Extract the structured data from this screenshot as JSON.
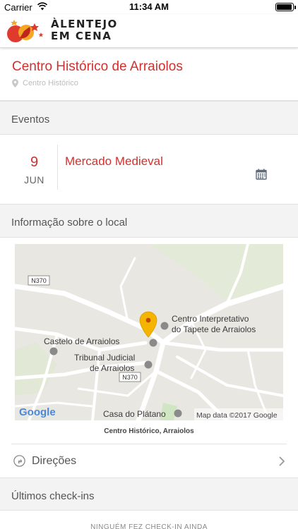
{
  "status_bar": {
    "carrier": "Carrier",
    "time": "11:34 AM",
    "battery_percent": 95
  },
  "header": {
    "logo_line1": "ÀLENTEJO",
    "logo_line2": "EM CENA"
  },
  "place": {
    "title": "Centro Histórico de Arraiolos",
    "subtitle": "Centro Histórico"
  },
  "sections": {
    "events": "Eventos",
    "info": "Informação sobre o local",
    "checkins": "Últimos check-ins"
  },
  "event": {
    "day": "9",
    "month": "JUN",
    "title": "Mercado Medieval"
  },
  "map": {
    "labels": {
      "road_top": "N370",
      "road_mid": "N370",
      "interp_line1": "Centro Interpretativo",
      "interp_line2": "do Tapete de Arraiolos",
      "castle": "Castelo de Arraiolos",
      "court_line1": "Tribunal Judicial",
      "court_line2": "de Arraiolos",
      "casa": "Casa do Plátano",
      "google": "Google",
      "attribution": "Map data ©2017 Google"
    },
    "caption": "Centro Histórico, Arraiolos"
  },
  "directions": {
    "label": "Direções"
  },
  "checkins_empty": "NINGUÉM FEZ CHECK-IN AINDA",
  "colors": {
    "accent": "#d0312d",
    "pin": "#f5b400"
  }
}
